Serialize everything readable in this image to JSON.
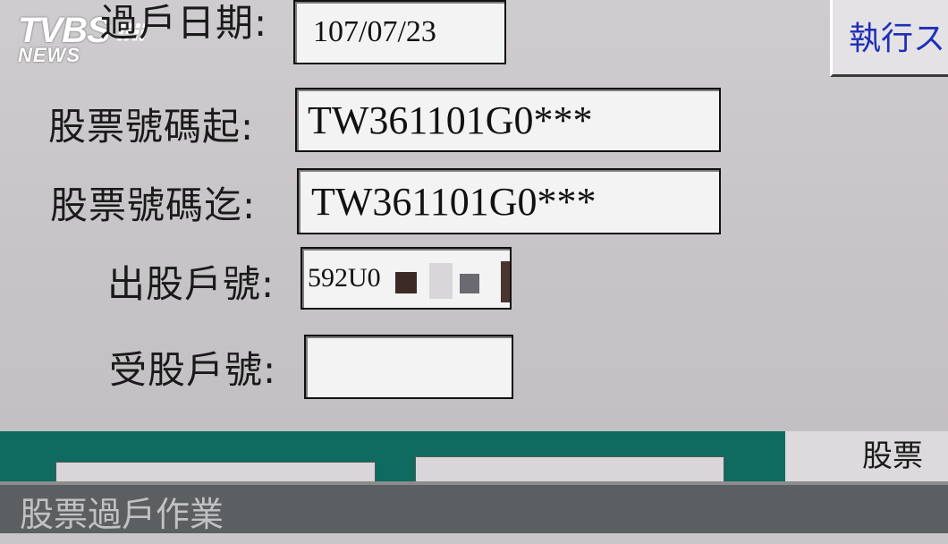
{
  "logo": {
    "main": "TVBS",
    "sub": "NEWS"
  },
  "form": {
    "transfer_date_label": "過戶日期:",
    "transfer_date_value": "107/07/23",
    "stock_no_from_label": "股票號碼起:",
    "stock_no_from_value": "TW361101G0***",
    "stock_no_to_label": "股票號碼迄:",
    "stock_no_to_value": "TW361101G0***",
    "seller_account_label": "出股戶號:",
    "seller_account_value": "592U0",
    "buyer_account_label": "受股戶號:",
    "buyer_account_value": ""
  },
  "execute_label": "執行ス",
  "tab_label": "股票",
  "status_bar": "股票過戶作業"
}
